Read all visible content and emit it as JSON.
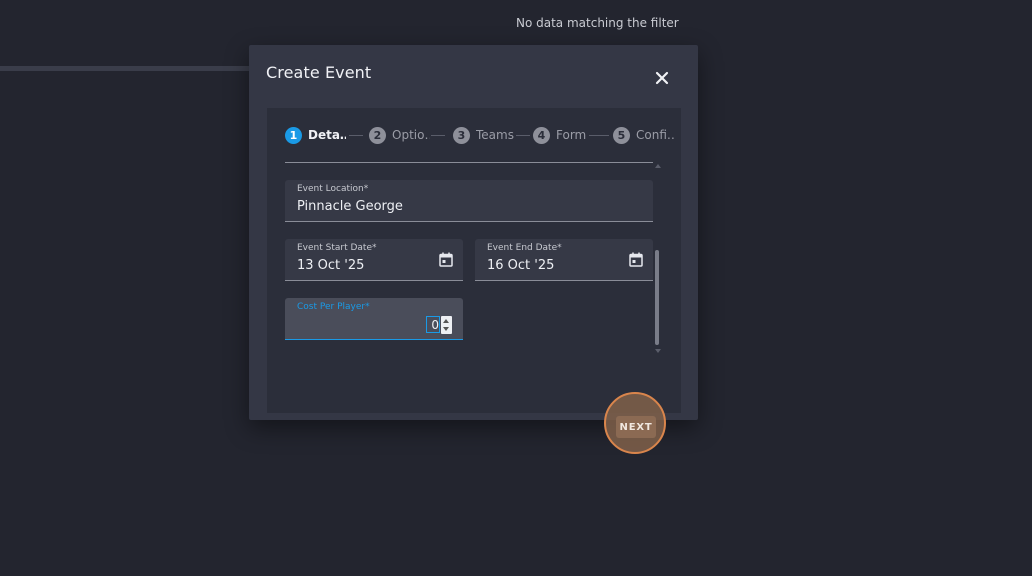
{
  "background": {
    "filter_message": "No data matching the filter"
  },
  "dialog": {
    "title": "Create Event",
    "close_icon": "close-icon",
    "stepper": {
      "steps": [
        {
          "number": "1",
          "label": "Deta…",
          "active": true
        },
        {
          "number": "2",
          "label": "Optio…",
          "active": false
        },
        {
          "number": "3",
          "label": "Teams",
          "active": false
        },
        {
          "number": "4",
          "label": "Form",
          "active": false
        },
        {
          "number": "5",
          "label": "Confi…",
          "active": false
        }
      ]
    },
    "fields": {
      "location": {
        "label": "Event Location*",
        "value": "Pinnacle George"
      },
      "start_date": {
        "label": "Event Start Date*",
        "value": "13 Oct '25",
        "icon": "calendar-icon"
      },
      "end_date": {
        "label": "Event End Date*",
        "value": "16 Oct '25",
        "icon": "calendar-icon"
      },
      "cost": {
        "label": "Cost Per Player*",
        "value": "0"
      }
    },
    "next_label": "NEXT"
  },
  "colors": {
    "accent": "#1a9ae6",
    "highlight": "#d9854c",
    "dialog_bg": "#343745",
    "page_bg": "#23252f"
  }
}
